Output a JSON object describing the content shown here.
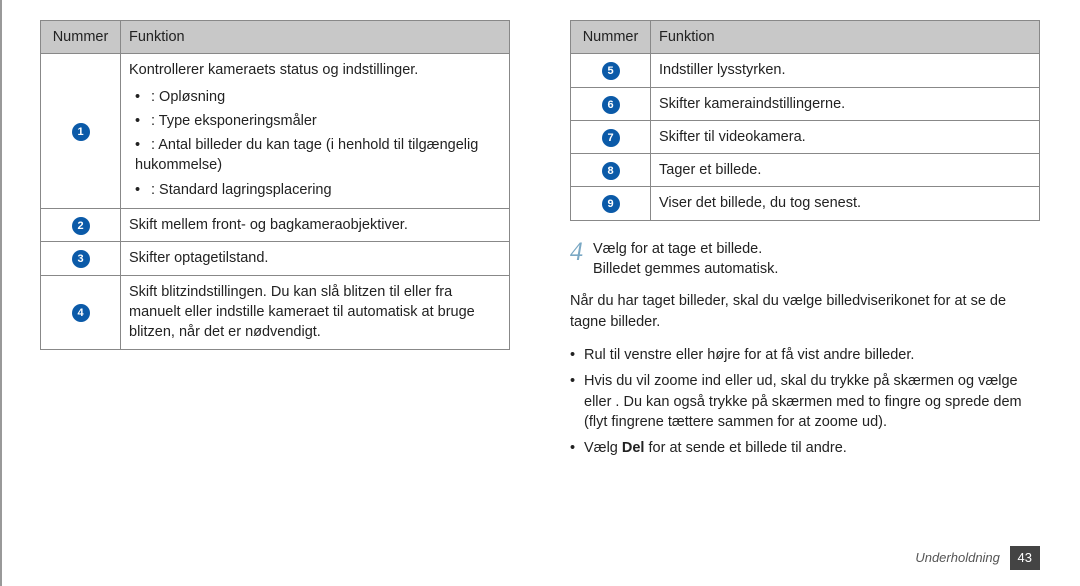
{
  "left_table": {
    "headers": {
      "num": "Nummer",
      "func": "Funktion"
    },
    "rows": [
      {
        "num": "1",
        "intro": "Kontrollerer kameraets status og indstillinger.",
        "bullets": [
          ": Opløsning",
          ": Type eksponeringsmåler",
          ": Antal billeder du kan tage (i henhold til tilgængelig hukommelse)",
          ": Standard lagringsplacering"
        ]
      },
      {
        "num": "2",
        "text": "Skift mellem front- og bagkameraobjektiver."
      },
      {
        "num": "3",
        "text": "Skifter optagetilstand."
      },
      {
        "num": "4",
        "text": "Skift blitzindstillingen. Du kan slå blitzen til eller fra manuelt eller indstille kameraet til automatisk at bruge blitzen, når det er nødvendigt."
      }
    ]
  },
  "right_table": {
    "headers": {
      "num": "Nummer",
      "func": "Funktion"
    },
    "rows": [
      {
        "num": "5",
        "text": "Indstiller lysstyrken."
      },
      {
        "num": "6",
        "text": "Skifter kameraindstillingerne."
      },
      {
        "num": "7",
        "text": "Skifter til videokamera."
      },
      {
        "num": "8",
        "text": "Tager et billede."
      },
      {
        "num": "9",
        "text": "Viser det billede, du tog senest."
      }
    ]
  },
  "step": {
    "num": "4",
    "line1": "Vælg       for at tage et billede.",
    "line2": "Billedet gemmes automatisk."
  },
  "para": "Når du har taget billeder, skal du vælge billedviserikonet for at se de tagne billeder.",
  "list": [
    "Rul til venstre eller højre for at få vist andre billeder.",
    "Hvis du vil zoome ind eller ud, skal du trykke på skærmen og vælge      eller    . Du kan også trykke på skærmen med to fingre og sprede dem (flyt fingrene tættere sammen for at zoome ud).",
    "Vælg Del for at sende et billede til andre."
  ],
  "list_bold_word": "Del",
  "footer": {
    "section": "Underholdning",
    "page": "43"
  }
}
